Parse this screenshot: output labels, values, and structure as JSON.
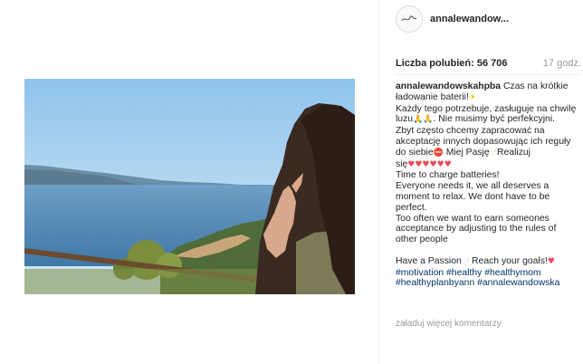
{
  "post": {
    "username": "annalewandow...",
    "likes_label": "Liczba polubień:",
    "likes_count": "56 706",
    "time_ago": "17 godz.",
    "caption": {
      "author": "annalewandowskahpba",
      "line1": " Czas na krótkie ładowanie baterii!",
      "line2": "Każdy tego potrzebuje, zasługuje na chwilę luzu",
      "line2b": ". Nie musimy być perfekcyjni.",
      "line3": "Zbyt często chcemy zapracować na akceptację innych dopasowując ich reguły do siebie",
      "line3b": " Miej Pasję ",
      "line3c": "Realizuj się",
      "line4": "Time to charge batteries!",
      "line5": "Everyone needs it, we all deserves a moment to relax. We dont have to be perfect.",
      "line6": "Too often we want to earn someones acceptance by adjusting to the rules of other people",
      "line7a": "Have a Passion ",
      "line7b": " Reach your goals!",
      "hashtags": "#motivation #healthy #healthymom #healthyplanbyann #annalewandowska"
    },
    "load_more_comments": "załaduj więcej komentarzy"
  },
  "icons": {
    "sun": "sun-emoji-icon",
    "pray": "praying-hands-emoji-icon",
    "hand": "pointing-hand-emoji-icon",
    "heart": "heart-emoji-icon",
    "no_entry": "no-entry-emoji-icon"
  },
  "colors": {
    "hashtag": "#003569",
    "muted": "#999999",
    "text": "#262626"
  }
}
